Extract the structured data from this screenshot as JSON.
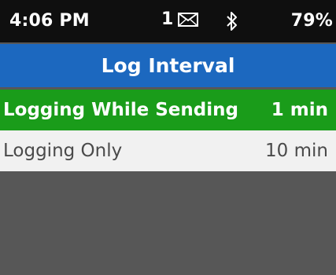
{
  "status": {
    "time": "4:06 PM",
    "message_count": "1",
    "message_icon": "envelope-icon",
    "bluetooth_icon": "bluetooth-icon",
    "battery": "79%"
  },
  "screen": {
    "title": "Log Interval"
  },
  "options": [
    {
      "label": "Logging While Sending",
      "value": "1 min",
      "selected": true
    },
    {
      "label": "Logging Only",
      "value": "10 min",
      "selected": false
    }
  ],
  "colors": {
    "status_bar": "#0f0f0f",
    "title_bar": "#1c68bf",
    "selected_row": "#1a9c1a",
    "normal_row": "#f1f1f1",
    "background": "#575757"
  }
}
